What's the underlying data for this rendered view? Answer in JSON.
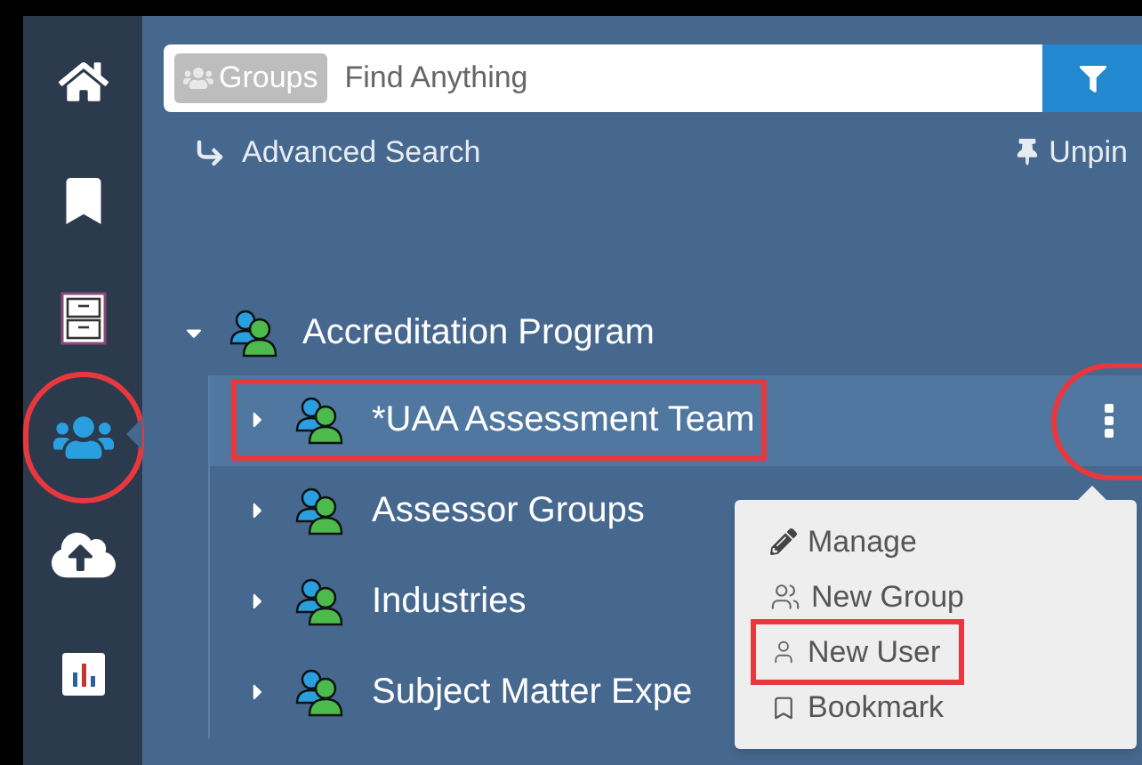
{
  "search": {
    "scope": "Groups",
    "placeholder": "Find Anything"
  },
  "links": {
    "advanced_search": "Advanced Search",
    "unpin": "Unpin"
  },
  "nav": [
    {
      "kind": "home",
      "selected": false,
      "highlighted": false
    },
    {
      "kind": "bookmark",
      "selected": false,
      "highlighted": false
    },
    {
      "kind": "cabinet",
      "selected": false,
      "highlighted": false
    },
    {
      "kind": "groups",
      "selected": true,
      "highlighted": true
    },
    {
      "kind": "upload",
      "selected": false,
      "highlighted": false
    },
    {
      "kind": "chart",
      "selected": false,
      "highlighted": false
    }
  ],
  "tree": {
    "label": "Accreditation Program",
    "expanded": true,
    "children": [
      {
        "label": "*UAA Assessment Team",
        "selected": true,
        "expanded": false,
        "highlighted": true
      },
      {
        "label": "Assessor Groups",
        "selected": false,
        "expanded": false,
        "highlighted": false
      },
      {
        "label": "Industries",
        "selected": false,
        "expanded": false,
        "highlighted": false
      },
      {
        "label": "Subject Matter Expe",
        "selected": false,
        "expanded": false,
        "highlighted": false
      }
    ]
  },
  "row_menu": {
    "highlighted": true,
    "items": [
      {
        "kind": "manage",
        "label": "Manage",
        "highlighted": false
      },
      {
        "kind": "group",
        "label": "New Group",
        "highlighted": false
      },
      {
        "kind": "user",
        "label": "New User",
        "highlighted": true
      },
      {
        "kind": "bookmark",
        "label": "Bookmark",
        "highlighted": false
      }
    ]
  }
}
